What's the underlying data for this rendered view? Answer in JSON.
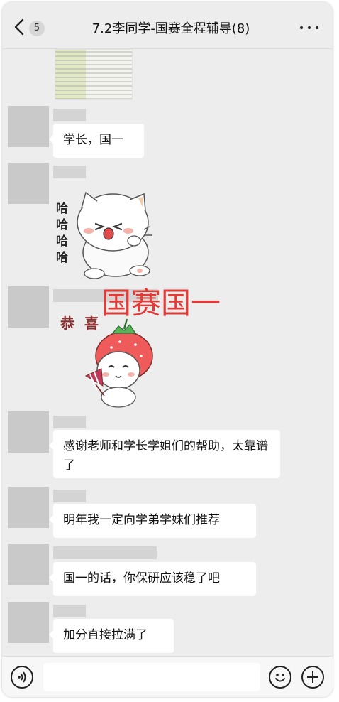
{
  "header": {
    "unread_count": "5",
    "title": "7.2李同学-国赛全程辅导(8)"
  },
  "messages": [
    {
      "text": "学长，国一"
    },
    {
      "text": "感谢老师和学长学姐们的帮助，太靠谱了"
    },
    {
      "text": "明年我一定向学弟学妹们推荐"
    },
    {
      "text": "国一的话，你保研应该稳了吧"
    },
    {
      "text": "加分直接拉满了"
    }
  ],
  "stickers": {
    "haha_text": "哈哈哈哈",
    "congrats_text": "恭喜",
    "overlay_text": "国赛国一"
  },
  "input": {
    "placeholder": ""
  },
  "colors": {
    "background": "#ededed",
    "bubble": "#ffffff",
    "overlay_red": "#e53935",
    "strawberry": "#ef5a5a"
  }
}
